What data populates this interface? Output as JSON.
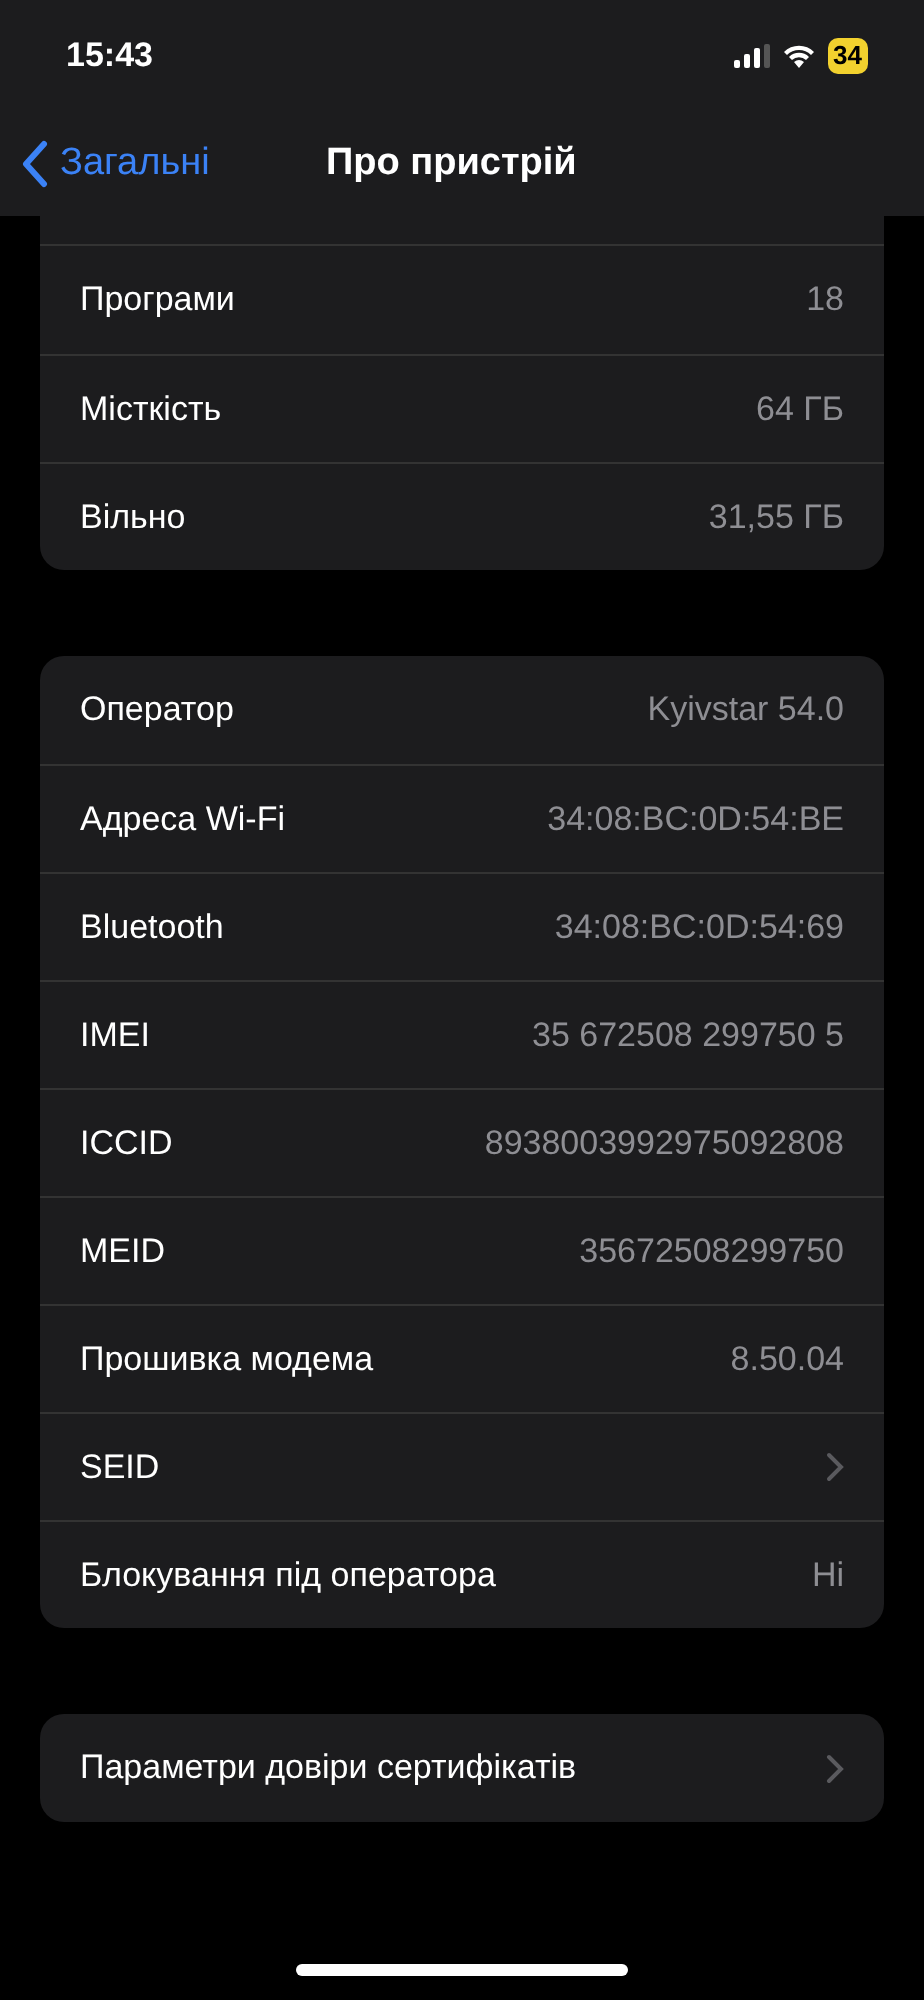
{
  "status_bar": {
    "time": "15:43",
    "battery": "34"
  },
  "nav": {
    "back": "Загальні",
    "title": "Про пристрій"
  },
  "groups": [
    {
      "cut_top": true,
      "rows": [
        {
          "kind": "value",
          "label": "Програми",
          "value": "18"
        },
        {
          "kind": "value",
          "label": "Місткість",
          "value": "64 ГБ"
        },
        {
          "kind": "value",
          "label": "Вільно",
          "value": "31,55 ГБ"
        }
      ]
    },
    {
      "cut_top": false,
      "rows": [
        {
          "kind": "value",
          "label": "Оператор",
          "value": "Kyivstar 54.0"
        },
        {
          "kind": "value",
          "label": "Адреса Wi-Fi",
          "value": "34:08:BC:0D:54:BE"
        },
        {
          "kind": "value",
          "label": "Bluetooth",
          "value": "34:08:BC:0D:54:69"
        },
        {
          "kind": "value",
          "label": "IMEI",
          "value": "35 672508 299750 5"
        },
        {
          "kind": "value",
          "label": "ICCID",
          "value": "8938003992975092808"
        },
        {
          "kind": "value",
          "label": "MEID",
          "value": "35672508299750"
        },
        {
          "kind": "value",
          "label": "Прошивка модема",
          "value": "8.50.04"
        },
        {
          "kind": "link",
          "label": "SEID"
        },
        {
          "kind": "value",
          "label": "Блокування під оператора",
          "value": "Ні"
        }
      ]
    },
    {
      "cut_top": false,
      "rows": [
        {
          "kind": "link",
          "label": "Параметри довіри сертифікатів"
        }
      ]
    }
  ]
}
